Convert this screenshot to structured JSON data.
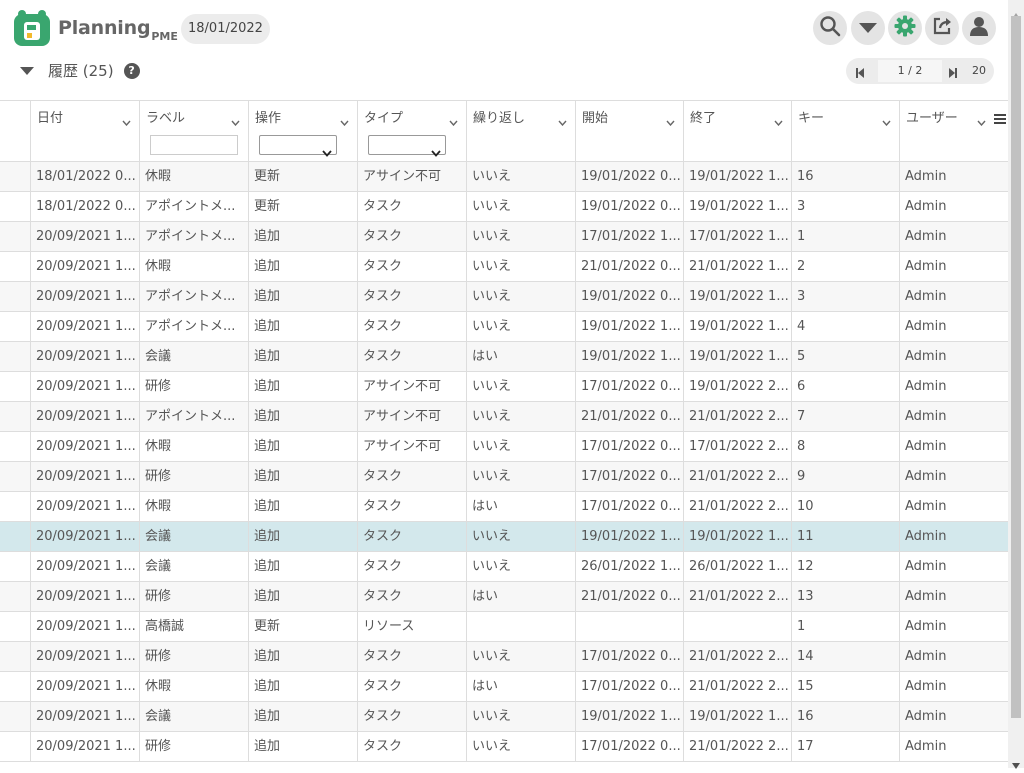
{
  "app": {
    "logo_text": "Planning",
    "logo_sub": "PME",
    "date": "18/01/2022"
  },
  "toolbar": {
    "buttons": [
      {
        "name": "search-button",
        "icon": "search-icon"
      },
      {
        "name": "filter-menu-button",
        "icon": "caret-down-icon"
      },
      {
        "name": "settings-button",
        "icon": "gear-icon"
      },
      {
        "name": "export-button",
        "icon": "export-icon"
      },
      {
        "name": "user-button",
        "icon": "user-icon"
      }
    ],
    "accent": "#3aa66f"
  },
  "section": {
    "title": "履歴 (25)",
    "help": "?"
  },
  "pager": {
    "page": "1 / 2",
    "page_size": "20"
  },
  "table": {
    "columns": [
      "",
      "日付",
      "ラベル",
      "操作",
      "タイプ",
      "繰り返し",
      "開始",
      "終了",
      "キー",
      "ユーザー"
    ],
    "rows": [
      [
        "18/01/2022 0...",
        "休暇",
        "更新",
        "アサイン不可",
        "いいえ",
        "19/01/2022 0...",
        "19/01/2022 1...",
        "16",
        "Admin"
      ],
      [
        "18/01/2022 0...",
        "アポイントメ...",
        "更新",
        "タスク",
        "いいえ",
        "19/01/2022 0...",
        "19/01/2022 1...",
        "3",
        "Admin"
      ],
      [
        "20/09/2021 1...",
        "アポイントメ...",
        "追加",
        "タスク",
        "いいえ",
        "17/01/2022 1...",
        "17/01/2022 1...",
        "1",
        "Admin"
      ],
      [
        "20/09/2021 1...",
        "休暇",
        "追加",
        "タスク",
        "いいえ",
        "21/01/2022 0...",
        "21/01/2022 1...",
        "2",
        "Admin"
      ],
      [
        "20/09/2021 1...",
        "アポイントメ...",
        "追加",
        "タスク",
        "いいえ",
        "19/01/2022 0...",
        "19/01/2022 1...",
        "3",
        "Admin"
      ],
      [
        "20/09/2021 1...",
        "アポイントメ...",
        "追加",
        "タスク",
        "いいえ",
        "19/01/2022 1...",
        "19/01/2022 1...",
        "4",
        "Admin"
      ],
      [
        "20/09/2021 1...",
        "会議",
        "追加",
        "タスク",
        "はい",
        "19/01/2022 1...",
        "19/01/2022 1...",
        "5",
        "Admin"
      ],
      [
        "20/09/2021 1...",
        "研修",
        "追加",
        "アサイン不可",
        "いいえ",
        "17/01/2022 0...",
        "19/01/2022 2...",
        "6",
        "Admin"
      ],
      [
        "20/09/2021 1...",
        "アポイントメ...",
        "追加",
        "アサイン不可",
        "いいえ",
        "21/01/2022 0...",
        "21/01/2022 2...",
        "7",
        "Admin"
      ],
      [
        "20/09/2021 1...",
        "休暇",
        "追加",
        "アサイン不可",
        "いいえ",
        "17/01/2022 0...",
        "17/01/2022 2...",
        "8",
        "Admin"
      ],
      [
        "20/09/2021 1...",
        "研修",
        "追加",
        "タスク",
        "いいえ",
        "17/01/2022 0...",
        "21/01/2022 2...",
        "9",
        "Admin"
      ],
      [
        "20/09/2021 1...",
        "休暇",
        "追加",
        "タスク",
        "はい",
        "17/01/2022 0...",
        "21/01/2022 2...",
        "10",
        "Admin"
      ],
      [
        "20/09/2021 1...",
        "会議",
        "追加",
        "タスク",
        "いいえ",
        "19/01/2022 1...",
        "19/01/2022 1...",
        "11",
        "Admin"
      ],
      [
        "20/09/2021 1...",
        "会議",
        "追加",
        "タスク",
        "いいえ",
        "26/01/2022 1...",
        "26/01/2022 1...",
        "12",
        "Admin"
      ],
      [
        "20/09/2021 1...",
        "研修",
        "追加",
        "タスク",
        "はい",
        "21/01/2022 0...",
        "21/01/2022 2...",
        "13",
        "Admin"
      ],
      [
        "20/09/2021 1...",
        "高橋誠",
        "更新",
        "リソース",
        "",
        "",
        "",
        "1",
        "Admin"
      ],
      [
        "20/09/2021 1...",
        "研修",
        "追加",
        "タスク",
        "いいえ",
        "17/01/2022 0...",
        "21/01/2022 2...",
        "14",
        "Admin"
      ],
      [
        "20/09/2021 1...",
        "休暇",
        "追加",
        "タスク",
        "はい",
        "17/01/2022 0...",
        "21/01/2022 2...",
        "15",
        "Admin"
      ],
      [
        "20/09/2021 1...",
        "会議",
        "追加",
        "タスク",
        "いいえ",
        "19/01/2022 1...",
        "19/01/2022 1...",
        "16",
        "Admin"
      ],
      [
        "20/09/2021 1...",
        "研修",
        "追加",
        "タスク",
        "いいえ",
        "17/01/2022 0...",
        "21/01/2022 2...",
        "17",
        "Admin"
      ]
    ],
    "selected_row": 12
  }
}
